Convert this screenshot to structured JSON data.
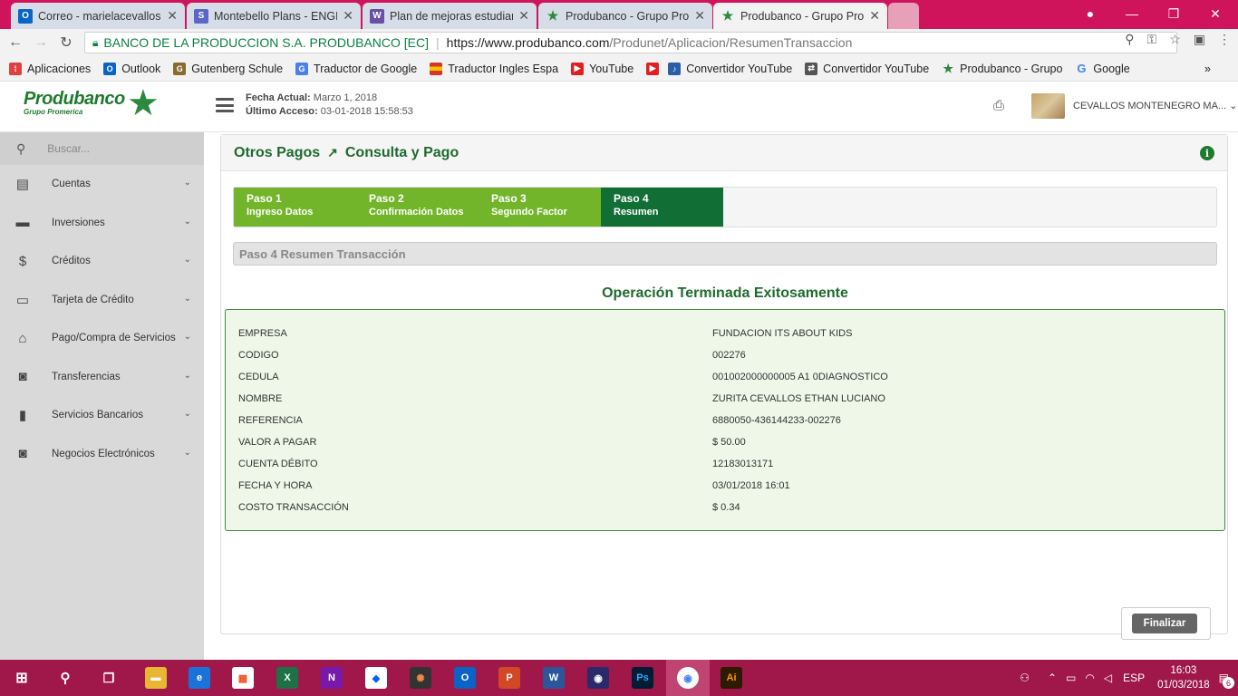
{
  "browser": {
    "tabs": [
      {
        "title": "Correo - marielacevallos",
        "fav": "O",
        "favcolor": "#0a64c5"
      },
      {
        "title": "Montebello Plans - ENGL",
        "fav": "S",
        "favcolor": "#5a67c9"
      },
      {
        "title": "Plan de mejoras estudiar",
        "fav": "W",
        "favcolor": "#6a4fa8"
      },
      {
        "title": "Produbanco - Grupo Pro",
        "fav": "★",
        "favcolor": "#2c8a3e"
      },
      {
        "title": "Produbanco - Grupo Pro",
        "fav": "★",
        "favcolor": "#2c8a3e"
      }
    ],
    "address": {
      "secure_label": "BANCO DE LA PRODUCCION S.A. PRODUBANCO [EC]",
      "url_host": "https://www.produbanco.com",
      "url_path": "/Produnet/Aplicacion/ResumenTransaccion"
    },
    "bookmarks": [
      {
        "label": "Aplicaciones",
        "icon": "apps-icon",
        "color": "#e04040"
      },
      {
        "label": "Outlook",
        "icon": "outlook-icon",
        "color": "#0a64c5"
      },
      {
        "label": "Gutenberg Schule",
        "icon": "gutenberg-icon",
        "color": "#8a6b2f"
      },
      {
        "label": "Traductor de Google",
        "icon": "translate-icon",
        "color": "#4a80e8"
      },
      {
        "label": "Traductor Ingles Espa",
        "icon": "flag-icon",
        "color": "#d8342a"
      },
      {
        "label": "YouTube",
        "icon": "youtube-icon",
        "color": "#e02020"
      },
      {
        "label": "",
        "icon": "youtube-icon",
        "color": "#e02020"
      },
      {
        "label": "Convertidor YouTube",
        "icon": "mp3-icon",
        "color": "#2a5fa8"
      },
      {
        "label": "Convertidor YouTube",
        "icon": "convert-icon",
        "color": "#555555"
      },
      {
        "label": "Produbanco - Grupo",
        "icon": "star-icon",
        "color": "#2c8a3e"
      },
      {
        "label": "Google",
        "icon": "google-icon",
        "color": "#4285f4"
      }
    ],
    "bookmarks_more": "»"
  },
  "header": {
    "logo_name": "Produbanco",
    "logo_sub": "Grupo Promerica",
    "fecha_label": "Fecha Actual:",
    "fecha_value": "Marzo 1, 2018",
    "acceso_label": "Último Acceso:",
    "acceso_value": "03-01-2018 15:58:53",
    "username": "CEVALLOS MONTENEGRO MA..."
  },
  "sidebar": {
    "search_placeholder": "Buscar...",
    "items": [
      {
        "label": "Cuentas",
        "icon": "accounts-icon",
        "glyph": "▤"
      },
      {
        "label": "Inversiones",
        "icon": "briefcase-icon",
        "glyph": "▬"
      },
      {
        "label": "Créditos",
        "icon": "dollar-icon",
        "glyph": "$"
      },
      {
        "label": "Tarjeta de Crédito",
        "icon": "credit-card-icon",
        "glyph": "▭"
      },
      {
        "label": "Pago/Compra de Servicios",
        "icon": "home-icon",
        "glyph": "⌂"
      },
      {
        "label": "Transferencias",
        "icon": "money-icon",
        "glyph": "◙"
      },
      {
        "label": "Servicios Bancarios",
        "icon": "suitcase-icon",
        "glyph": "▮"
      },
      {
        "label": "Negocios Electrónicos",
        "icon": "money-icon",
        "glyph": "◙"
      }
    ]
  },
  "panel": {
    "title_left": "Otros Pagos",
    "title_right": "Consulta y Pago",
    "steps": [
      {
        "num": "Paso 1",
        "label": "Ingreso Datos"
      },
      {
        "num": "Paso 2",
        "label": "Confirmación Datos"
      },
      {
        "num": "Paso 3",
        "label": "Segundo Factor"
      },
      {
        "num": "Paso 4",
        "label": "Resumen"
      }
    ],
    "active_step": 4,
    "section_title": "Paso 4 Resumen Transacción",
    "success_message": "Operación Terminada Exitosamente",
    "summary": [
      {
        "key": "EMPRESA",
        "value": "FUNDACION ITS ABOUT KIDS"
      },
      {
        "key": "CODIGO",
        "value": "002276"
      },
      {
        "key": "CEDULA",
        "value": "001002000000005 A1 0DIAGNOSTICO"
      },
      {
        "key": "NOMBRE",
        "value": "ZURITA CEVALLOS ETHAN LUCIANO"
      },
      {
        "key": "REFERENCIA",
        "value": "6880050-436144233-002276"
      },
      {
        "key": "VALOR A PAGAR",
        "value": "$ 50.00"
      },
      {
        "key": "CUENTA DÉBITO",
        "value": "12183013171"
      },
      {
        "key": "FECHA Y HORA",
        "value": "03/01/2018 16:01"
      },
      {
        "key": "COSTO TRANSACCIÓN",
        "value": "$ 0.34"
      }
    ],
    "finalize_label": "Finalizar"
  },
  "taskbar": {
    "apps": [
      {
        "name": "file-explorer-icon",
        "color": "#e8b634"
      },
      {
        "name": "edge-icon",
        "color": "#1a73d8"
      },
      {
        "name": "store-icon",
        "color": "#ffffff"
      },
      {
        "name": "excel-icon",
        "color": "#1e7145"
      },
      {
        "name": "onenote-icon",
        "color": "#7719aa"
      },
      {
        "name": "dropbox-icon",
        "color": "#0061fe"
      },
      {
        "name": "photos-icon",
        "color": "#333333"
      },
      {
        "name": "outlook-icon",
        "color": "#0a64c5"
      },
      {
        "name": "powerpoint-icon",
        "color": "#d24726"
      },
      {
        "name": "word-icon",
        "color": "#2b579a"
      },
      {
        "name": "media-icon",
        "color": "#2a2a6a"
      },
      {
        "name": "photoshop-icon",
        "color": "#001d34"
      },
      {
        "name": "chrome-icon",
        "color": "#4285f4"
      },
      {
        "name": "illustrator-icon",
        "color": "#2e1a00"
      }
    ],
    "language": "ESP",
    "time": "16:03",
    "date": "01/03/2018",
    "notifications": "6"
  }
}
